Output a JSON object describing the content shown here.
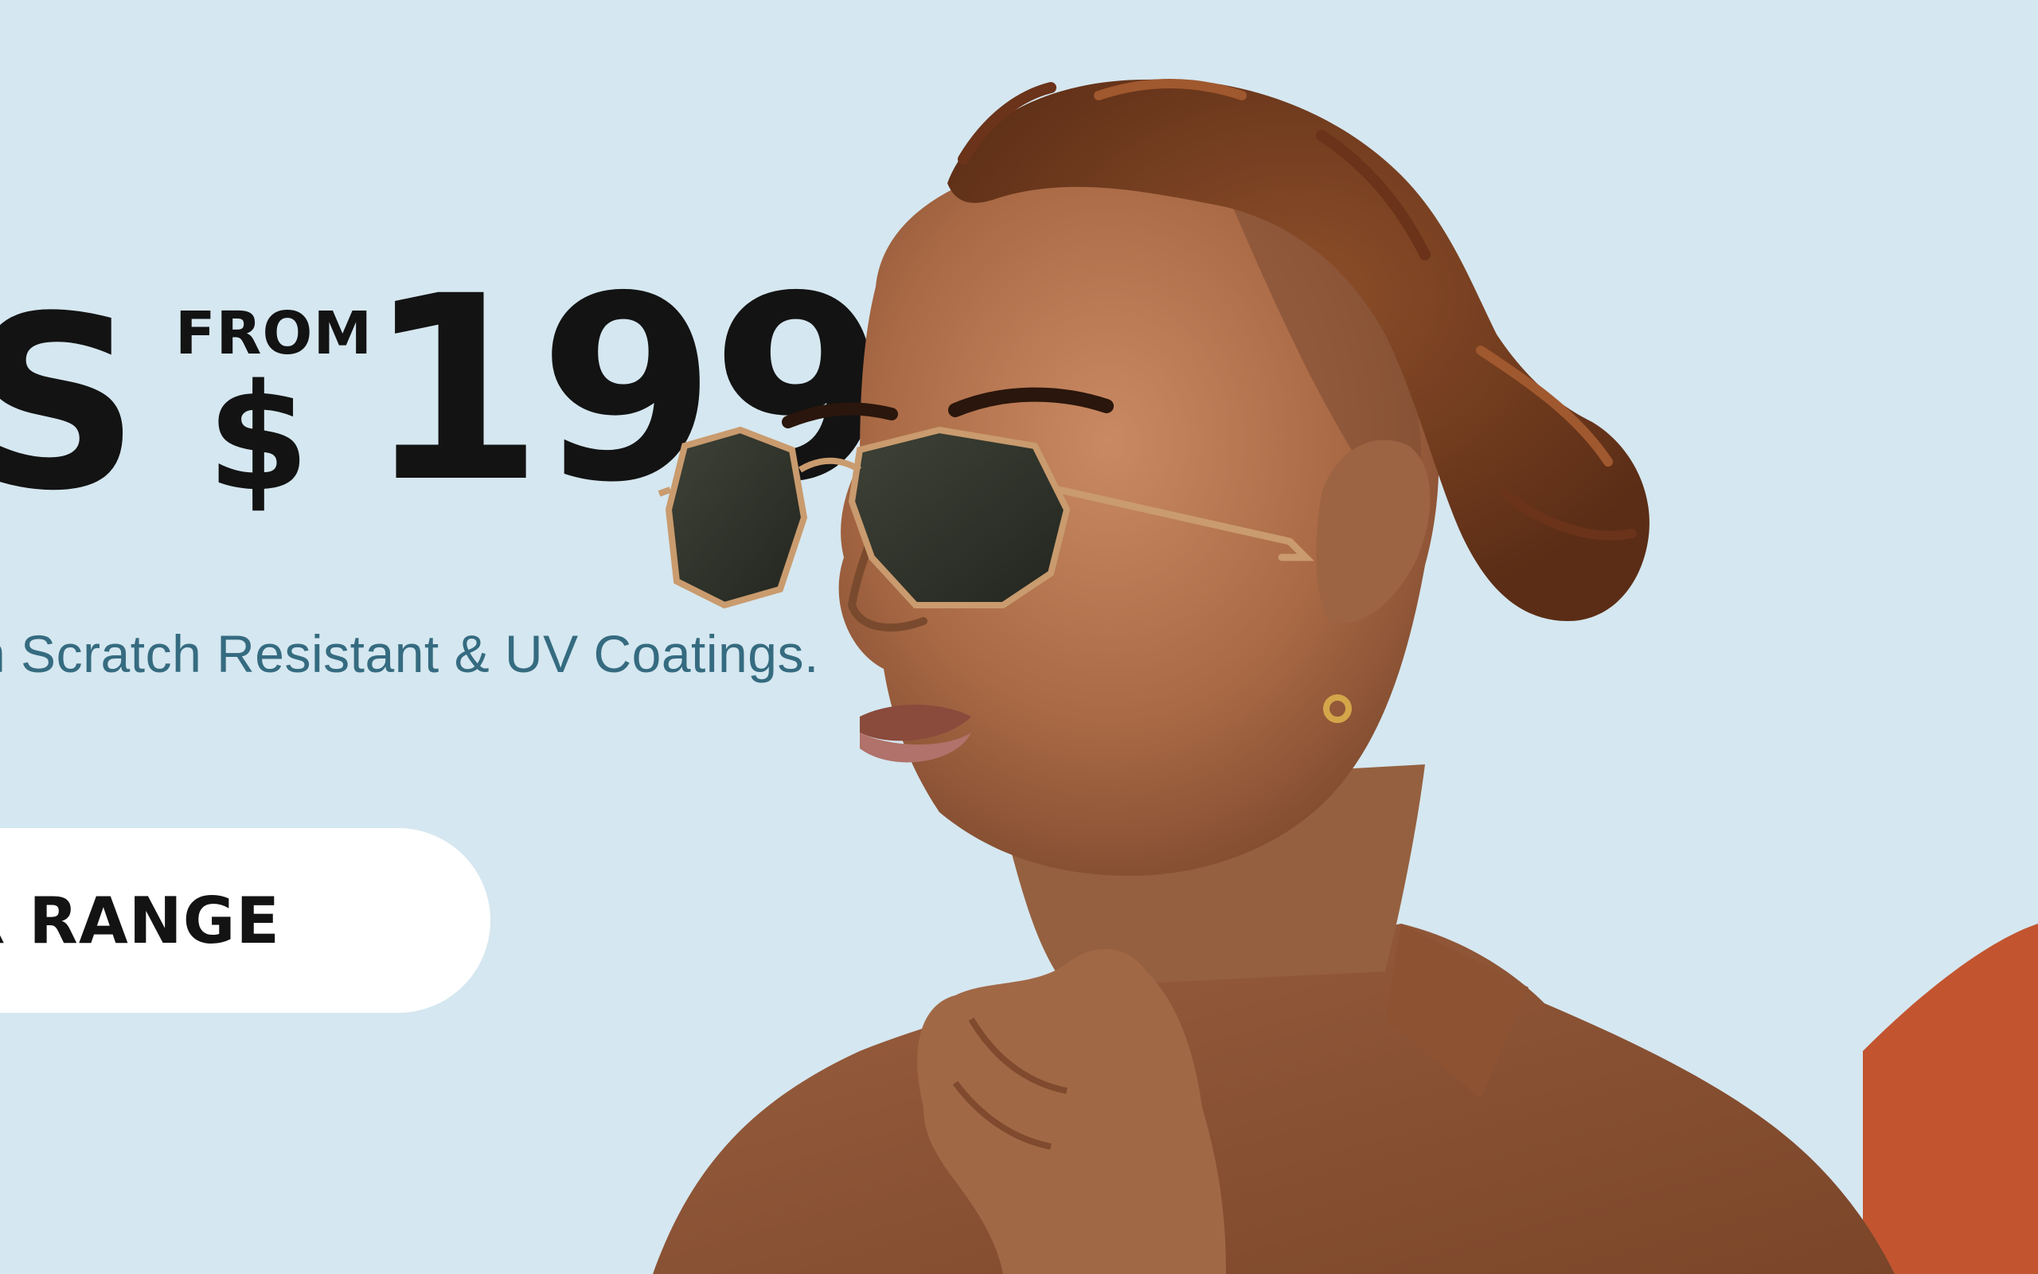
{
  "hero": {
    "headline_lead": "S",
    "from_label": "FROM",
    "currency_symbol": "$",
    "price": "199",
    "subtitle": "h Scratch Resistant & UV Coatings.",
    "cta_label": "R RANGE"
  },
  "colors": {
    "background": "#d5e7f0",
    "headline": "#131313",
    "subtitle": "#356b80",
    "cta_background": "#ffffff"
  },
  "image": {
    "subject": "man-wearing-gold-octagonal-sunglasses"
  }
}
